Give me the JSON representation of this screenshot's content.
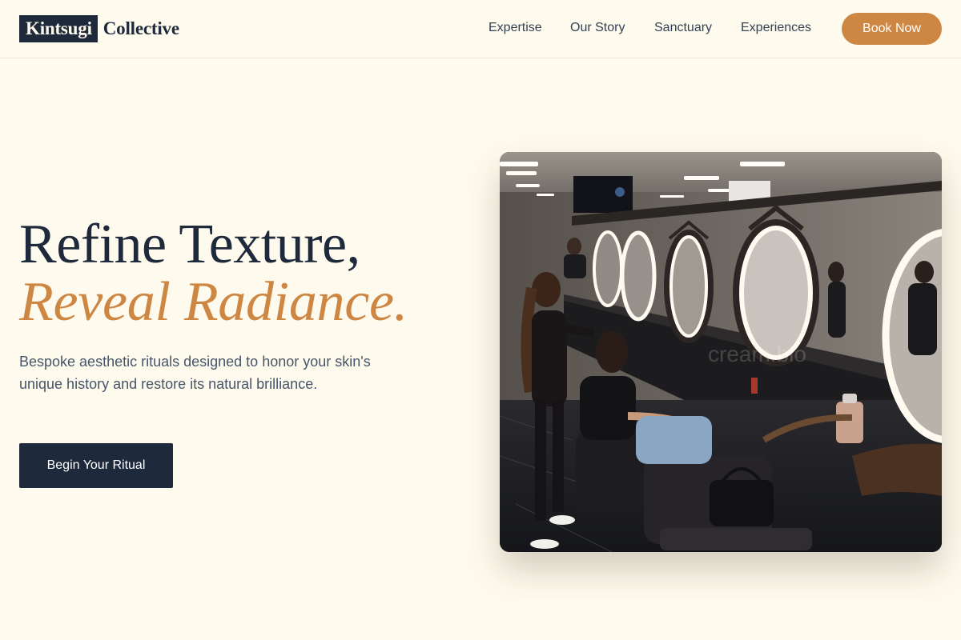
{
  "brand": {
    "name_boxed": "Kintsugi",
    "name_rest": "Collective"
  },
  "nav": {
    "items": [
      {
        "label": "Expertise"
      },
      {
        "label": "Our Story"
      },
      {
        "label": "Sanctuary"
      },
      {
        "label": "Experiences"
      }
    ],
    "cta_label": "Book Now"
  },
  "hero": {
    "title_line1": "Refine Texture,",
    "title_line2": "Reveal Radiance.",
    "subtitle": "Bespoke aesthetic rituals designed to honor your skin's unique history and restore its natural brilliance.",
    "cta_label": "Begin Your Ritual",
    "image_watermark": "cream.bio"
  },
  "colors": {
    "background": "#fefbee",
    "navy": "#1e293b",
    "accent": "#cd8743",
    "body_text": "#475569"
  }
}
